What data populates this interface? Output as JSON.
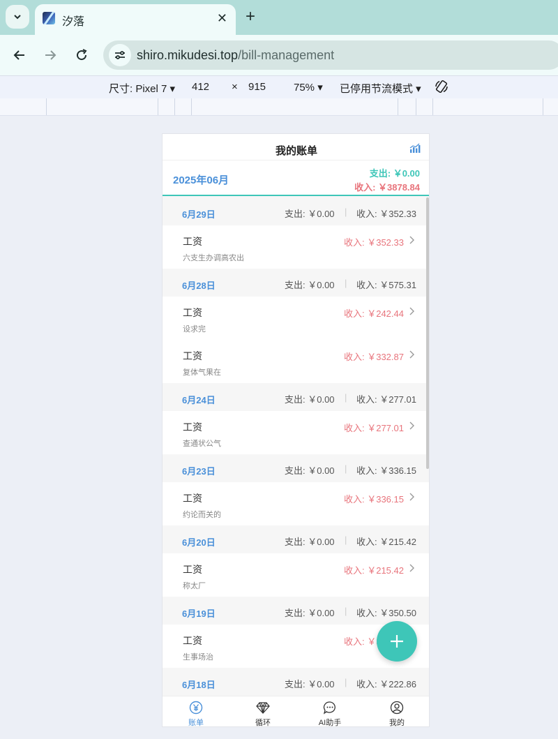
{
  "browser": {
    "tab_title": "汐落",
    "url_host": "shiro.mikudesi.top",
    "url_path": "/bill-management"
  },
  "devtools": {
    "device_label": "尺寸: Pixel 7",
    "width": "412",
    "times": "×",
    "height": "915",
    "zoom": "75%",
    "throttle": "已停用节流模式"
  },
  "app": {
    "title": "我的账单",
    "month": "2025年06月",
    "total_expense": "支出: ￥0.00",
    "total_income": "收入: ￥3878.84"
  },
  "days": [
    {
      "date": "6月29日",
      "expense": "支出: ￥0.00",
      "income": "收入: ￥352.33",
      "items": [
        {
          "category": "工资",
          "note": "六支生办调高农出",
          "amount": "收入: ￥352.33"
        }
      ]
    },
    {
      "date": "6月28日",
      "expense": "支出: ￥0.00",
      "income": "收入: ￥575.31",
      "items": [
        {
          "category": "工资",
          "note": "设求完",
          "amount": "收入: ￥242.44"
        },
        {
          "category": "工资",
          "note": "复体气果在",
          "amount": "收入: ￥332.87"
        }
      ]
    },
    {
      "date": "6月24日",
      "expense": "支出: ￥0.00",
      "income": "收入: ￥277.01",
      "items": [
        {
          "category": "工资",
          "note": "查通状公气",
          "amount": "收入: ￥277.01"
        }
      ]
    },
    {
      "date": "6月23日",
      "expense": "支出: ￥0.00",
      "income": "收入: ￥336.15",
      "items": [
        {
          "category": "工资",
          "note": "约论而关的",
          "amount": "收入: ￥336.15"
        }
      ]
    },
    {
      "date": "6月20日",
      "expense": "支出: ￥0.00",
      "income": "收入: ￥215.42",
      "items": [
        {
          "category": "工资",
          "note": "称太厂",
          "amount": "收入: ￥215.42"
        }
      ]
    },
    {
      "date": "6月19日",
      "expense": "支出: ￥0.00",
      "income": "收入: ￥350.50",
      "items": [
        {
          "category": "工资",
          "note": "生事场治",
          "amount": "收入: ￥350.50"
        }
      ]
    },
    {
      "date": "6月18日",
      "expense": "支出: ￥0.00",
      "income": "收入: ￥222.86",
      "items": []
    }
  ],
  "nav": [
    {
      "label": "账单",
      "icon": "yen-circle-icon",
      "active": true
    },
    {
      "label": "循环",
      "icon": "diamond-icon",
      "active": false
    },
    {
      "label": "AI助手",
      "icon": "chat-bubble-icon",
      "active": false
    },
    {
      "label": "我的",
      "icon": "user-icon",
      "active": false
    }
  ],
  "colors": {
    "accent_teal": "#3ec6b8",
    "income_red": "#e8747c",
    "date_blue": "#4a90d9"
  }
}
